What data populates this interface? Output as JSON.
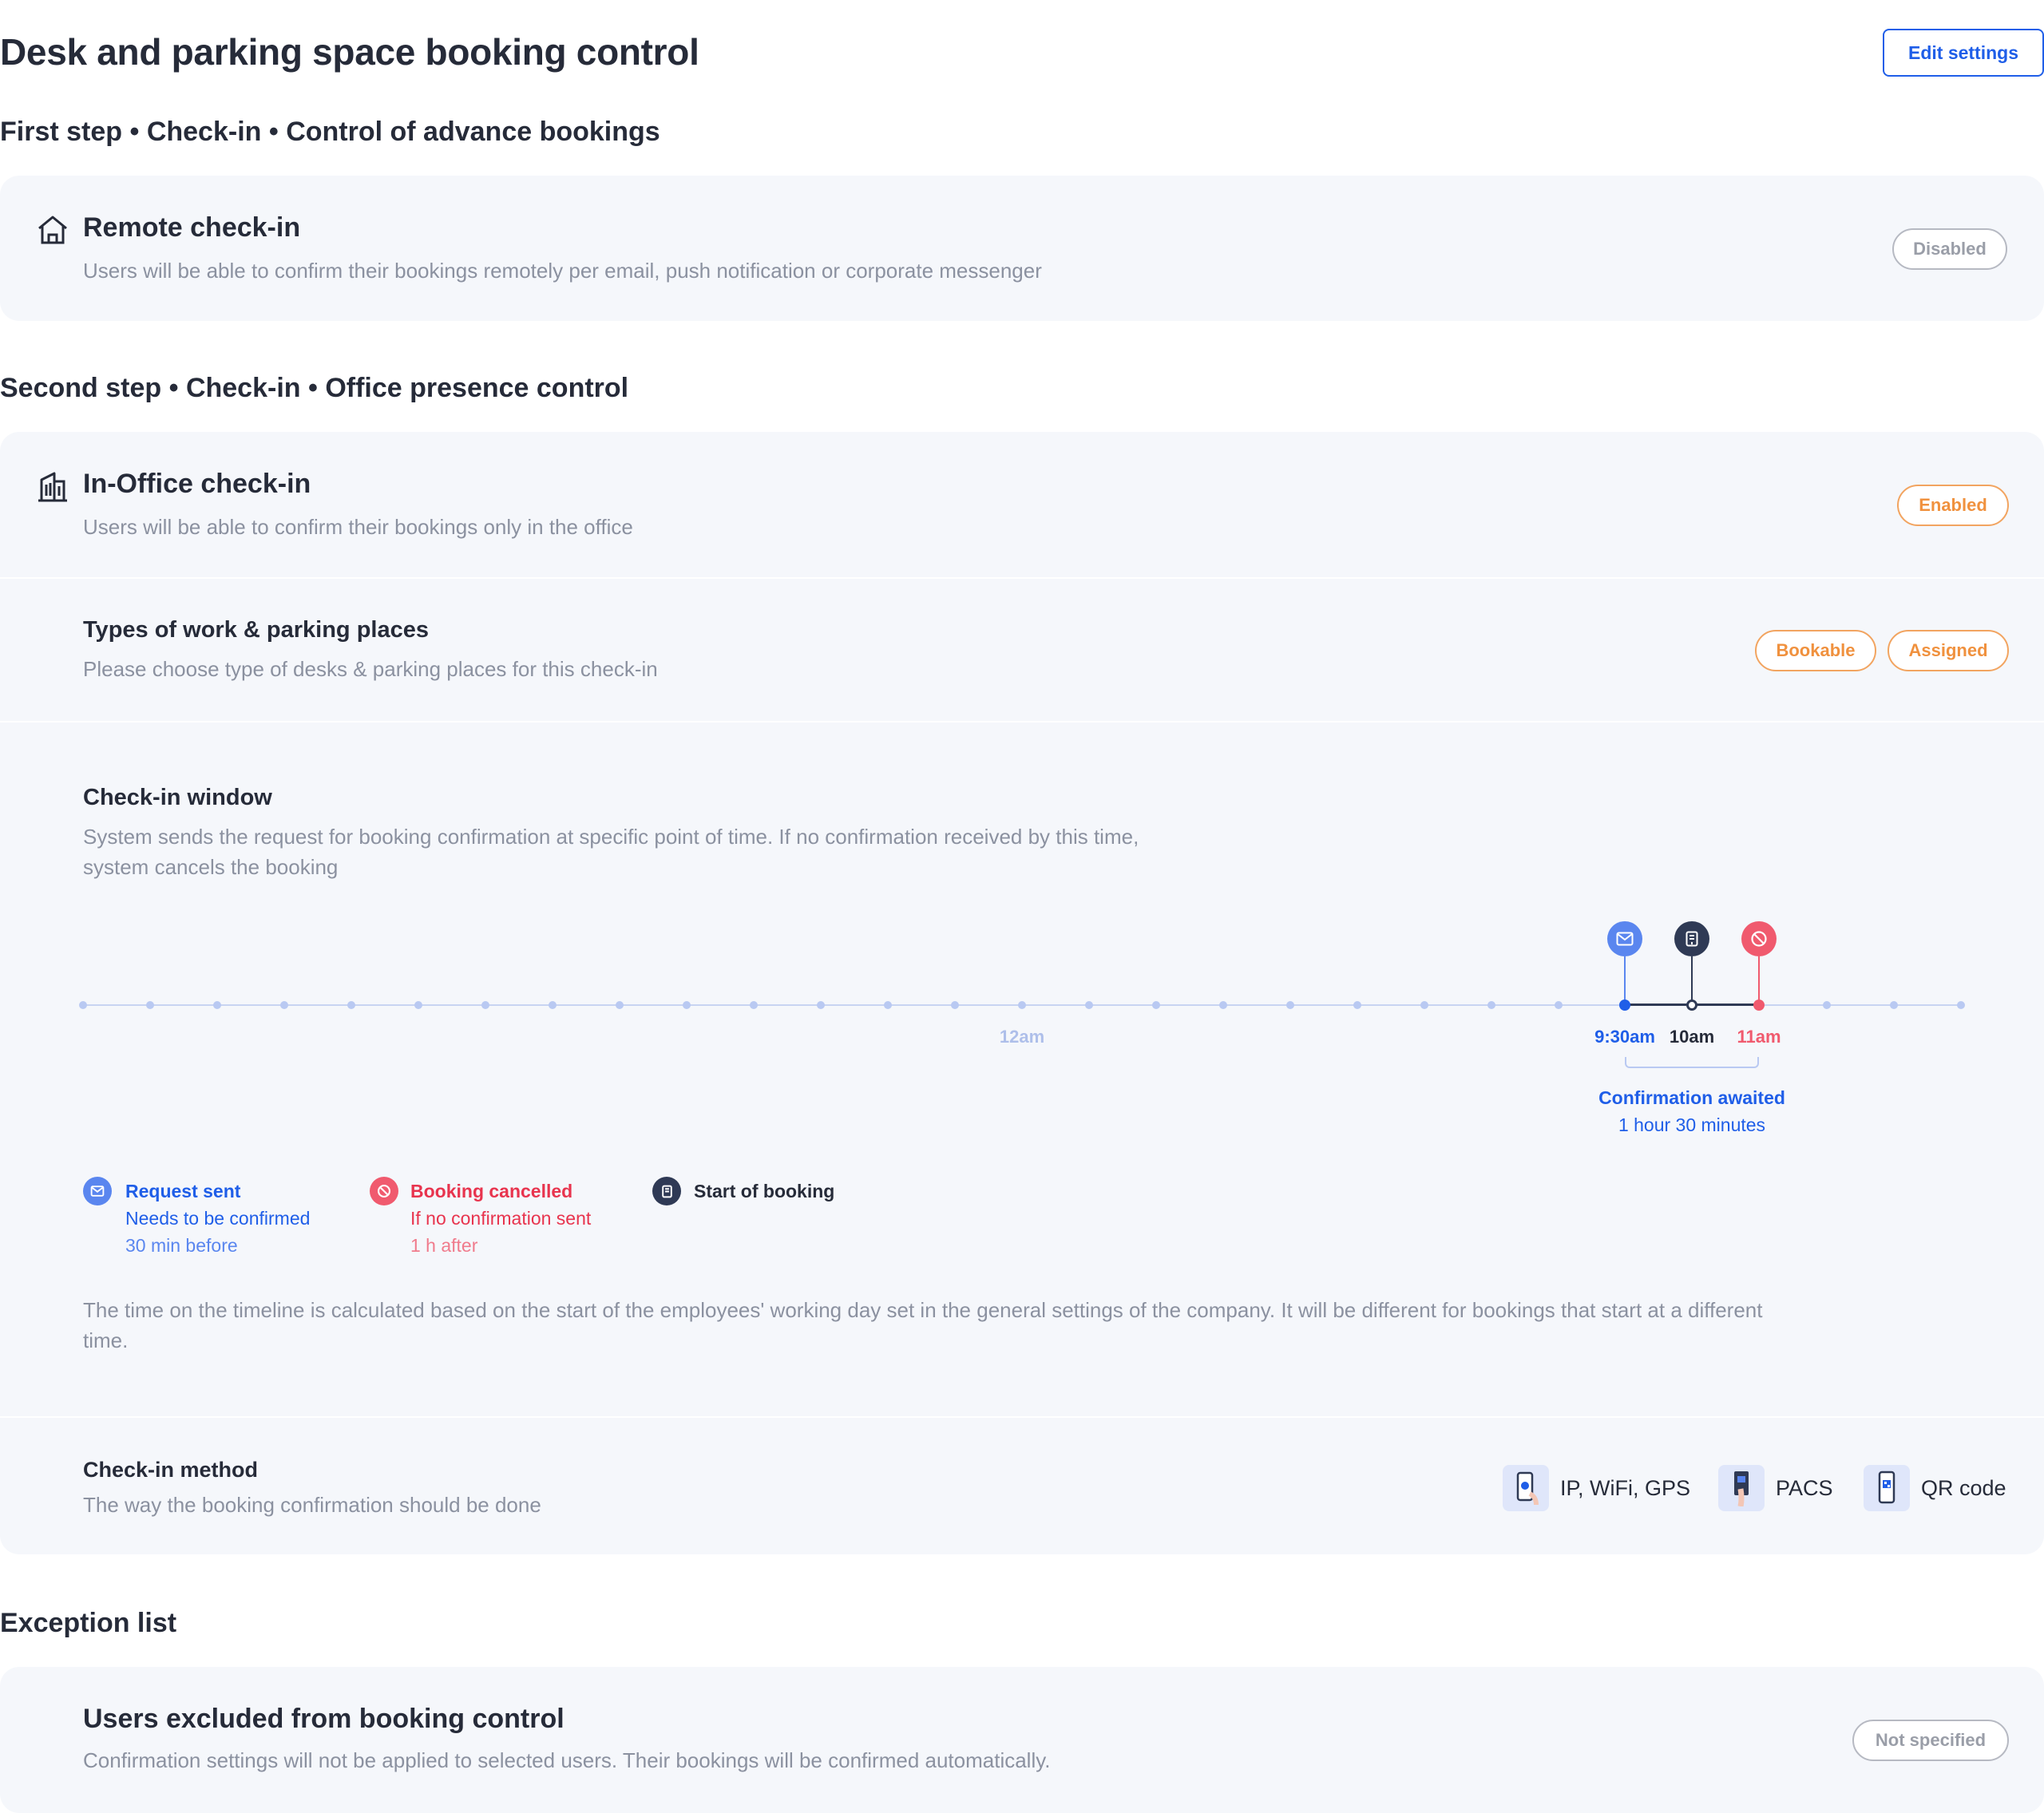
{
  "header": {
    "title": "Desk and parking space booking control",
    "edit_button": "Edit settings"
  },
  "first_step": {
    "title": "First step • Check-in • Control of advance bookings",
    "remote": {
      "title": "Remote check-in",
      "description": "Users will be able to confirm their bookings remotely per email, push notification or corporate messenger",
      "status": "Disabled",
      "icon": "home-icon"
    }
  },
  "second_step": {
    "title": "Second step • Check-in • Office presence control",
    "in_office": {
      "title": "In-Office check-in",
      "description": "Users will be able to confirm their bookings only in the office",
      "status": "Enabled",
      "icon": "building-icon"
    },
    "types": {
      "title": "Types of work & parking places",
      "description": "Please choose type of desks & parking places for this check-in",
      "tags": [
        "Bookable",
        "Assigned"
      ]
    },
    "window": {
      "title": "Check-in window",
      "description_line1": "System sends the request for booking confirmation at specific point of time. If no confirmation received by this time,",
      "description_line2": "system cancels the booking",
      "timeline": {
        "label_midnight": "12am",
        "label_request": "9:30am",
        "label_start": "10am",
        "label_cancel": "11am",
        "awaited_title": "Confirmation awaited",
        "awaited_duration": "1 hour 30 minutes"
      },
      "legend": [
        {
          "title": "Request sent",
          "line2": "Needs to be confirmed",
          "line3": "30 min before"
        },
        {
          "title": "Booking cancelled",
          "line2": "If no confirmation sent",
          "line3": "1 h after"
        },
        {
          "title": "Start of booking"
        }
      ],
      "note_line1": "The time on the timeline is calculated based on the start of the employees' working day set in the general settings of the company. It will be different for bookings that start at a different",
      "note_line2": "time."
    },
    "method": {
      "title": "Check-in method",
      "description": "The way the booking confirmation should be done",
      "options": [
        "IP, WiFi, GPS",
        "PACS",
        "QR code"
      ]
    }
  },
  "exceptions": {
    "title": "Exception list",
    "excluded": {
      "title": "Users excluded from booking control",
      "description": "Confirmation settings will not be applied to selected users. Their bookings will be confirmed automatically.",
      "status": "Not specified"
    }
  },
  "colors": {
    "accent": "#1f5ee8",
    "orange": "#f0913e",
    "red": "#f05a6e",
    "dark": "#2f3a55",
    "card": "#f5f7fb"
  }
}
